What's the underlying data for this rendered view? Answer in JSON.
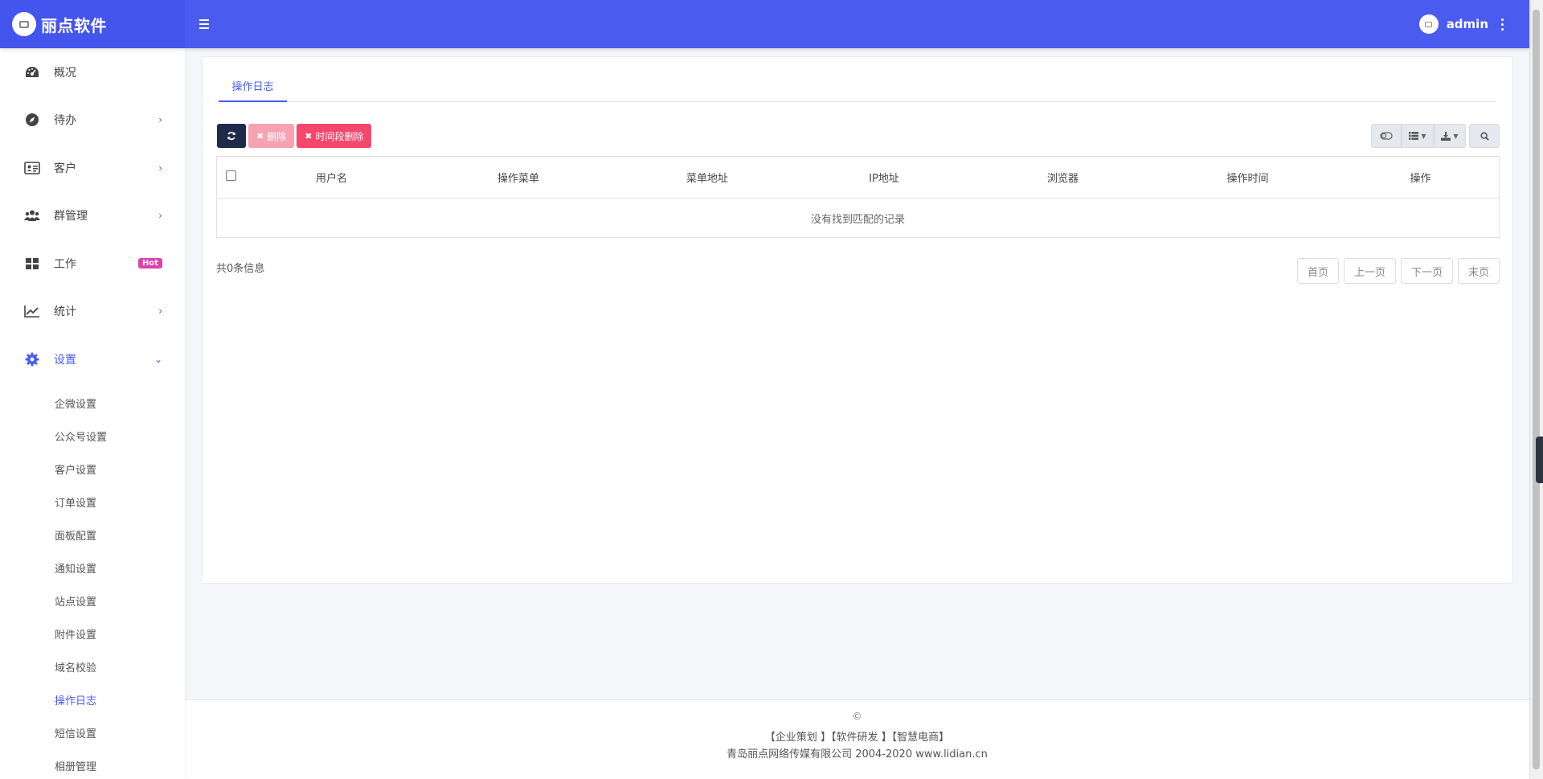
{
  "brand": {
    "name": "丽点软件"
  },
  "user": {
    "name": "admin"
  },
  "sidebar": {
    "items": [
      {
        "label": "概况",
        "icon": "dashboard-icon"
      },
      {
        "label": "待办",
        "icon": "compass-icon"
      },
      {
        "label": "客户",
        "icon": "id-card-icon"
      },
      {
        "label": "群管理",
        "icon": "users-icon"
      },
      {
        "label": "工作",
        "icon": "grid-icon",
        "badge": "Hot"
      },
      {
        "label": "统计",
        "icon": "line-chart-icon"
      },
      {
        "label": "设置",
        "icon": "gear-icon"
      }
    ],
    "sub_items": [
      "企微设置",
      "公众号设置",
      "客户设置",
      "订单设置",
      "面板配置",
      "通知设置",
      "站点设置",
      "附件设置",
      "域名校验",
      "操作日志",
      "短信设置",
      "相册管理"
    ]
  },
  "tabs": [
    {
      "label": "操作日志"
    }
  ],
  "toolbar": {
    "delete_label": "删除",
    "time_delete_label": "时间段删除"
  },
  "table": {
    "columns": [
      "用户名",
      "操作菜单",
      "菜单地址",
      "IP地址",
      "浏览器",
      "操作时间",
      "操作"
    ],
    "empty_text": "没有找到匹配的记录"
  },
  "pagination": {
    "total_text": "共0条信息",
    "first": "首页",
    "prev": "上一页",
    "next": "下一页",
    "last": "末页"
  },
  "footer": {
    "copyright": "©",
    "links": "【企业策划 】【软件研发 】【智慧电商】",
    "company": "青岛丽点网络传媒有限公司 2004-2020 www.lidian.cn"
  },
  "colors": {
    "accent": "#4a5bf0",
    "dark_button": "#1d2a4a",
    "danger": "#f5476c",
    "badge": "#e040b0"
  }
}
